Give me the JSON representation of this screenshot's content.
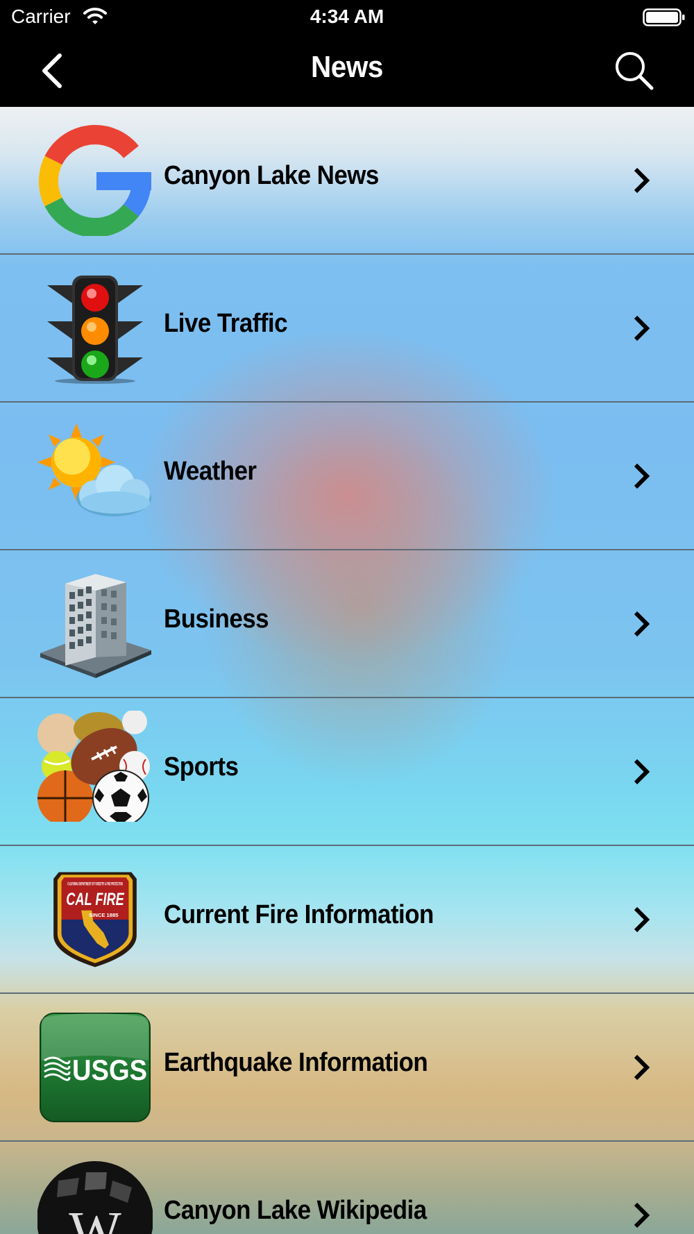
{
  "status_bar": {
    "carrier": "Carrier",
    "time": "4:34 AM"
  },
  "nav": {
    "title": "News",
    "back_icon": "chevron-left-icon",
    "search_icon": "search-icon"
  },
  "menu": {
    "items": [
      {
        "label": "Canyon Lake News",
        "icon": "google-logo-icon"
      },
      {
        "label": "Live Traffic",
        "icon": "traffic-light-icon"
      },
      {
        "label": "Weather",
        "icon": "sun-cloud-icon"
      },
      {
        "label": "Business",
        "icon": "office-building-icon"
      },
      {
        "label": "Sports",
        "icon": "sports-balls-icon"
      },
      {
        "label": "Current Fire Information",
        "icon": "cal-fire-badge-icon"
      },
      {
        "label": "Earthquake Information",
        "icon": "usgs-logo-icon"
      },
      {
        "label": "Canyon Lake Wikipedia",
        "icon": "wikipedia-globe-icon"
      }
    ]
  },
  "logos": {
    "calfire_top": "CALIFORNIA DEPARTMENT OF FORESTRY & FIRE PROTECTION",
    "calfire_main": "CAL FIRE",
    "calfire_since": "SINCE 1885",
    "usgs": "USGS"
  }
}
